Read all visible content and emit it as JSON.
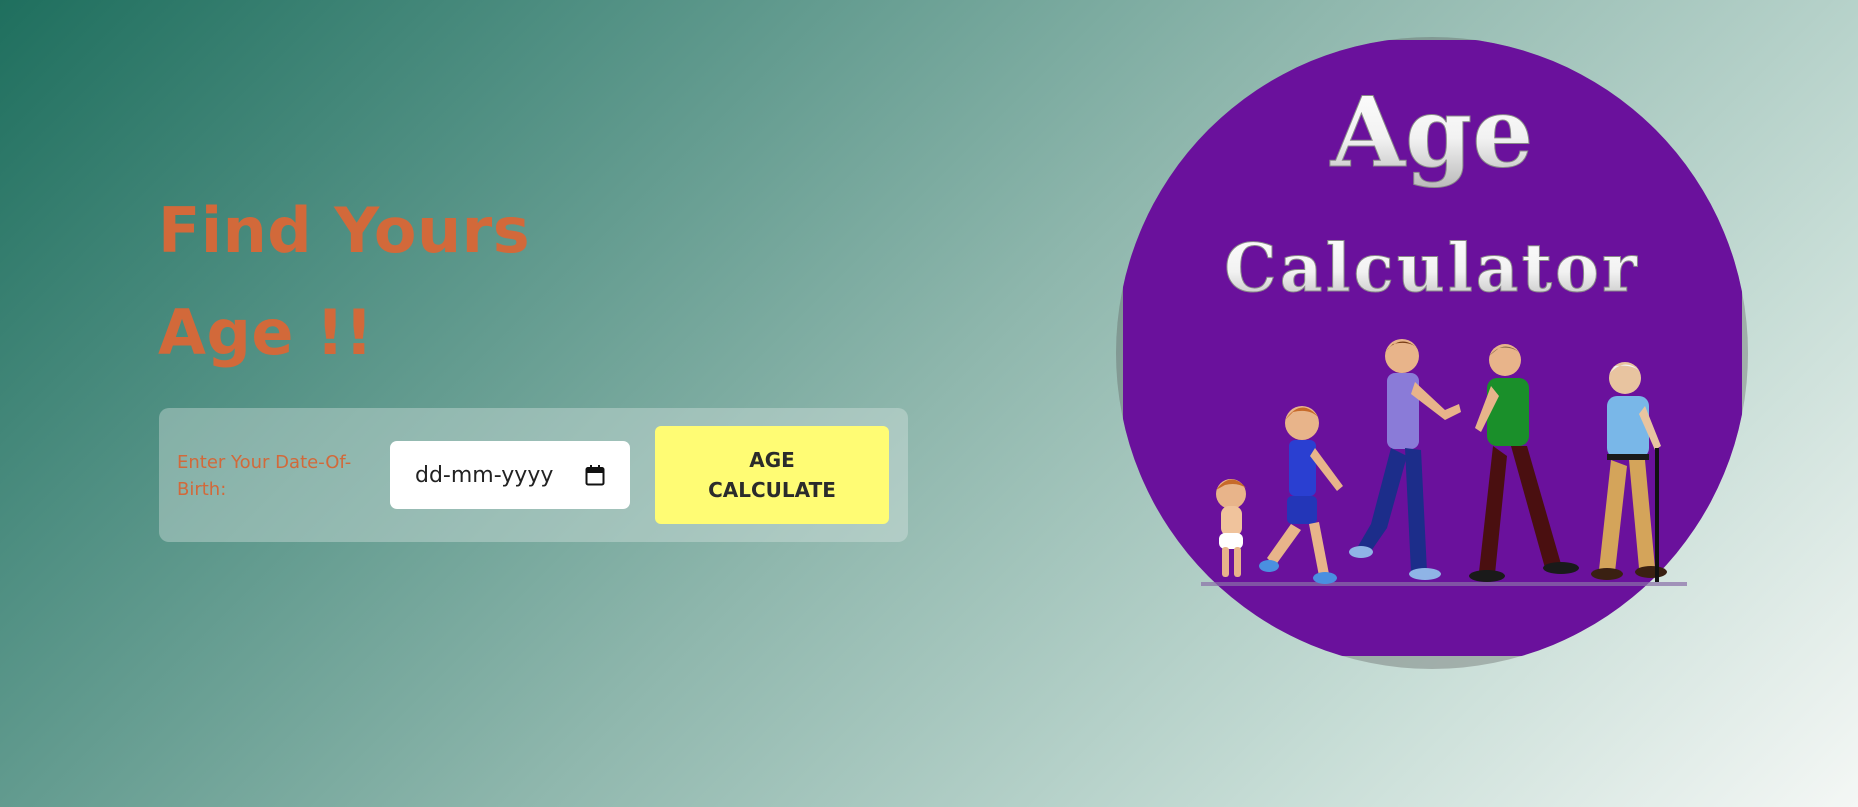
{
  "heading": {
    "line1": "Find Yours",
    "line2": "Age !!"
  },
  "form": {
    "label": "Enter Your Date-Of-Birth:",
    "date_placeholder": "dd-mm-yyyy",
    "button_label": "AGE CALCULATE"
  },
  "logo": {
    "title_line1": "Age",
    "title_line2": "Calculator",
    "background_color": "#6a119c"
  },
  "colors": {
    "heading": "#d2693a",
    "button": "#fffc74",
    "gradient_start": "#1f6f5e",
    "gradient_end": "#f4f7f5"
  },
  "icons": {
    "date_picker": "calendar-icon"
  }
}
